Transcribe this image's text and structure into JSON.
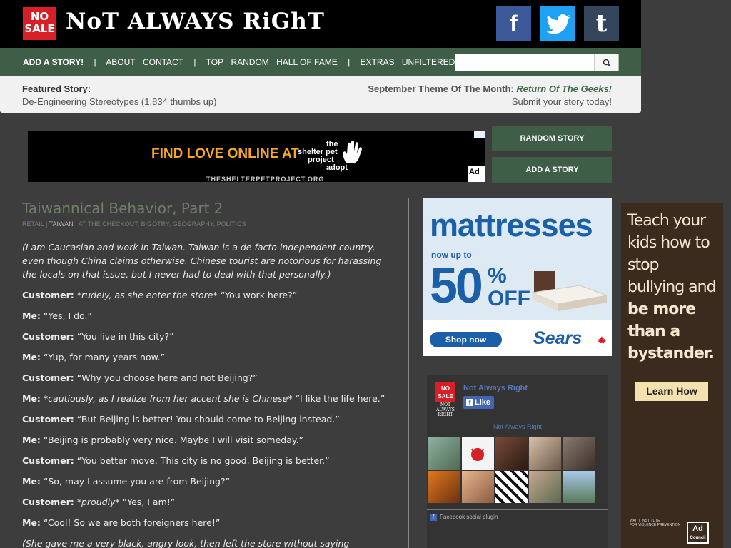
{
  "header": {
    "logo_badge_line1": "NO",
    "logo_badge_line2": "SALE",
    "site_title": "NoT ALWAYS RiGhT",
    "social": {
      "facebook": "f",
      "twitter": "twitter-bird-icon",
      "tumblr": "t"
    }
  },
  "nav": {
    "items": [
      {
        "label": "ADD A STORY!"
      },
      {
        "label": "|"
      },
      {
        "label": "ABOUT"
      },
      {
        "label": "CONTACT"
      },
      {
        "label": "|"
      },
      {
        "label": "TOP"
      },
      {
        "label": "RANDOM"
      },
      {
        "label": "HALL OF FAME"
      },
      {
        "label": "|"
      },
      {
        "label": "EXTRAS"
      },
      {
        "label": "UNFILTERED"
      }
    ],
    "search_value": ""
  },
  "featured": {
    "label": "Featured Story:",
    "story": "De-Engineering Stereotypes (1,834 thumbs up)",
    "theme_label": "September Theme Of The Month:",
    "theme_name": "Return Of The Geeks!",
    "submit": "Submit your story today!"
  },
  "top_ad": {
    "headline": "FIND LOVE ONLINE AT",
    "brand_lines": [
      "the",
      "shelter pet",
      "project",
      "adopt"
    ],
    "url": "THESHELTERPETPROJECT.ORG",
    "corner": "Ad"
  },
  "side_buttons": {
    "random": "RANDOM STORY",
    "add": "ADD A STORY"
  },
  "story": {
    "title": "Taiwannical Behavior, Part 2",
    "tags": {
      "t1": "RETAIL",
      "sep1": "|",
      "t2": "TAIWAN",
      "sep2": "|",
      "t3": "AT THE CHECKOUT, BIGOTRY, GEOGRAPHY, POLITICS"
    },
    "intro": "(I am Caucasian and work in Taiwan. Taiwan is a de facto independent country, even though China claims otherwise. Chinese tourist are notorious for harassing the locals on that issue, but I never had to deal with that personally.)",
    "lines": [
      {
        "speaker": "Customer:",
        "action": "*rudely, as she enter the store*",
        "text": " “You work here?”"
      },
      {
        "speaker": "Me:",
        "action": "",
        "text": " “Yes, I do.”"
      },
      {
        "speaker": "Customer:",
        "action": "",
        "text": " “You live in this city?”"
      },
      {
        "speaker": "Me:",
        "action": "",
        "text": " “Yup, for many years now.”"
      },
      {
        "speaker": "Customer:",
        "action": "",
        "text": " “Why you choose here and not Beijing?”"
      },
      {
        "speaker": "Me:",
        "action": "*cautiously, as I realize from her accent she is Chinese*",
        "text": " “I like the life here.”"
      },
      {
        "speaker": "Customer:",
        "action": "",
        "text": " “But Beijing is better! You should come to Beijing instead.”"
      },
      {
        "speaker": "Me:",
        "action": "",
        "text": " “Beijing is probably very nice. Maybe I will visit someday.”"
      },
      {
        "speaker": "Customer:",
        "action": "",
        "text": " “You better move. This city is no good. Beijing is better.”"
      },
      {
        "speaker": "Me:",
        "action": "",
        "text": " “So, may I assume you are from Beijing?”"
      },
      {
        "speaker": "Customer:",
        "action": "*proudly*",
        "text": " “Yes, I am!”"
      },
      {
        "speaker": "Me:",
        "action": "",
        "text": " “Cool! So we are both foreigners here!”"
      }
    ],
    "outro": "(She gave me a very black, angry look, then left the store without saying another word.)"
  },
  "sears_ad": {
    "title": "mattresses",
    "now_up_to": "now up to",
    "percent": "50",
    "percent_sign": "%",
    "off": "OFF",
    "shop_now": "Shop now",
    "brand": "Sears"
  },
  "fb_widget": {
    "badge_line1": "NO",
    "badge_line2": "SALE",
    "wordmark_line1": "NOT ALWAYS",
    "wordmark_line2": "RIGHT",
    "page_name": "Not Always Right",
    "like": "Like",
    "caption": "Not Always Right",
    "plugin": "Facebook social plugin"
  },
  "bully_ad": {
    "line1": "Teach your",
    "line2": "kids how to stop",
    "line3": "bullying and",
    "line4": "be more than a",
    "line5": "bystander.",
    "cta": "Learn How",
    "waitt": "WAITT INSTITUTE",
    "waitt_sub": "FOR VIOLENCE PREVENTION",
    "adcouncil_line1": "Ad",
    "adcouncil_line2": "Council"
  }
}
